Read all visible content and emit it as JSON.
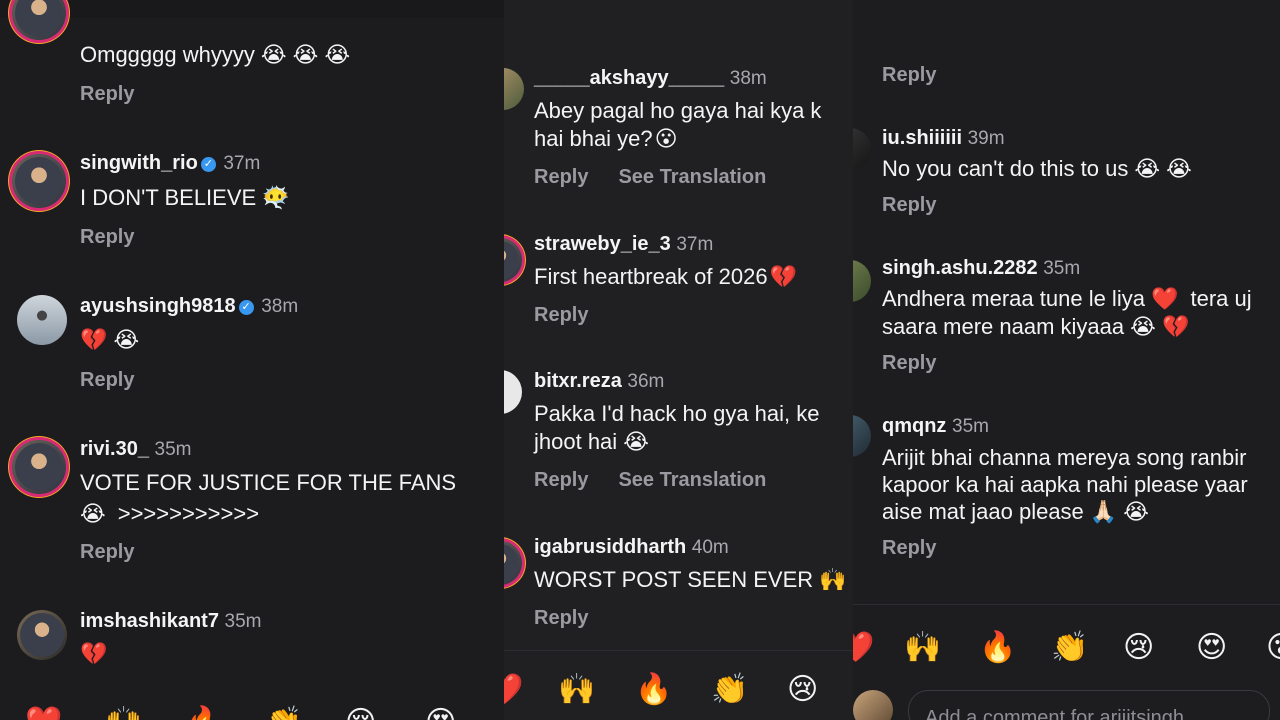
{
  "panel1": {
    "comments": [
      {
        "text": "Omggggg whyyyy",
        "emoji": "😭 😭 😭",
        "reply": "Reply"
      },
      {
        "username": "singwith_rio",
        "verified": true,
        "time": "37m",
        "text": "I DON'T BELIEVE",
        "emoji": "😶‍🌫️",
        "reply": "Reply"
      },
      {
        "username": "ayushsingh9818",
        "verified": true,
        "time": "38m",
        "text": "",
        "emoji": "💔 😭",
        "reply": "Reply"
      },
      {
        "username": "rivi.30_",
        "verified": false,
        "time": "35m",
        "text": "VOTE FOR JUSTICE FOR THE FANS",
        "text2": ">>>>>>>>>>>",
        "emoji2": "😭",
        "reply": "Reply"
      },
      {
        "username": "imshashikant7",
        "verified": false,
        "time": "35m",
        "text": "",
        "emoji": "💔"
      }
    ],
    "reactions": [
      "❤️",
      "🙌",
      "🔥",
      "👏",
      "😢",
      "😍"
    ]
  },
  "panel2": {
    "comments": [
      {
        "username": "_____akshayy_____",
        "time": "38m",
        "text": "Abey pagal ho gaya hai kya k",
        "text2": "hai bhai ye?",
        "emoji2": "😮",
        "reply": "Reply",
        "see_translation": "See Translation"
      },
      {
        "username": "straweby_ie_3",
        "time": "37m",
        "text": "First heartbreak of 2026",
        "emoji": "💔",
        "reply": "Reply"
      },
      {
        "username": "bitxr.reza",
        "time": "36m",
        "text": "Pakka I'd hack ho gya hai, ke",
        "text2": "jhoot hai",
        "emoji2": "😭",
        "reply": "Reply",
        "see_translation": "See Translation"
      },
      {
        "username": "igabrusiddharth",
        "time": "40m",
        "text": "WORST POST SEEN EVER",
        "emoji": "🙌",
        "reply": "Reply"
      }
    ],
    "reactions": [
      "❤️",
      "🙌",
      "🔥",
      "👏",
      "😢"
    ]
  },
  "panel3": {
    "top_reply": "Reply",
    "comments": [
      {
        "username": "iu.shiiiiii",
        "time": "39m",
        "text": "No you can't do this to us",
        "emoji": "😭 😭",
        "reply": "Reply"
      },
      {
        "username": "singh.ashu.2282",
        "time": "35m",
        "text": "Andhera meraa tune le liya",
        "emoji": "❤️",
        "text_after": "tera uj",
        "text2": "saara mere naam kiyaaa",
        "emoji2": "😭 💔",
        "reply": "Reply"
      },
      {
        "username": "qmqnz",
        "time": "35m",
        "text": "Arijit bhai channa mereya song ranbir",
        "text2": "kapoor ka hai aapka nahi please yaar",
        "text3": "aise mat jaao please",
        "emoji3": "🙏🏻 😭",
        "reply": "Reply"
      }
    ],
    "reactions": [
      "❤️",
      "🙌",
      "🔥",
      "👏",
      "😢",
      "😍",
      "😮"
    ],
    "add_comment_placeholder": "Add a comment for arijitsingh..."
  }
}
